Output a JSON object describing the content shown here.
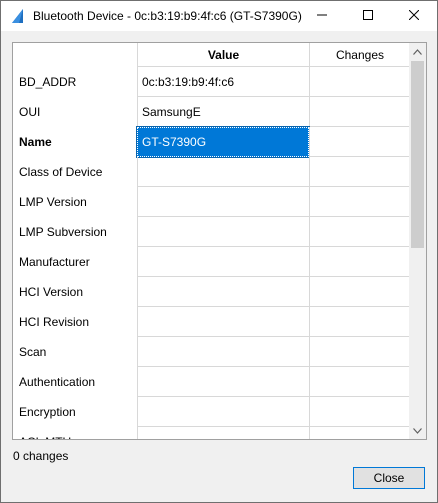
{
  "window": {
    "title": "Bluetooth Device - 0c:b3:19:b9:4f:c6 (GT-S7390G)"
  },
  "grid": {
    "headers": {
      "label": "",
      "value": "Value",
      "changes": "Changes"
    },
    "rows": [
      {
        "label": "BD_ADDR",
        "value": "0c:b3:19:b9:4f:c6",
        "changes": "",
        "bold": false,
        "selected": false
      },
      {
        "label": "OUI",
        "value": "SamsungE",
        "changes": "",
        "bold": false,
        "selected": false
      },
      {
        "label": "Name",
        "value": "GT-S7390G",
        "changes": "",
        "bold": true,
        "selected": true
      },
      {
        "label": "Class of Device",
        "value": "",
        "changes": "",
        "bold": false,
        "selected": false
      },
      {
        "label": "LMP Version",
        "value": "",
        "changes": "",
        "bold": false,
        "selected": false
      },
      {
        "label": "LMP Subversion",
        "value": "",
        "changes": "",
        "bold": false,
        "selected": false
      },
      {
        "label": "Manufacturer",
        "value": "",
        "changes": "",
        "bold": false,
        "selected": false
      },
      {
        "label": "HCI Version",
        "value": "",
        "changes": "",
        "bold": false,
        "selected": false
      },
      {
        "label": "HCI Revision",
        "value": "",
        "changes": "",
        "bold": false,
        "selected": false
      },
      {
        "label": "Scan",
        "value": "",
        "changes": "",
        "bold": false,
        "selected": false
      },
      {
        "label": "Authentication",
        "value": "",
        "changes": "",
        "bold": false,
        "selected": false
      },
      {
        "label": "Encryption",
        "value": "",
        "changes": "",
        "bold": false,
        "selected": false
      },
      {
        "label": "ACL MTU",
        "value": "",
        "changes": "",
        "bold": false,
        "selected": false
      }
    ]
  },
  "status": {
    "text": "0 changes"
  },
  "buttons": {
    "close": "Close"
  },
  "icons": {
    "app": "bluetooth-sail-icon",
    "minimize": "minimize-icon",
    "maximize": "maximize-icon",
    "close": "close-icon",
    "scroll_up": "chevron-up-icon",
    "scroll_down": "chevron-down-icon"
  },
  "colors": {
    "selection": "#0078d7",
    "accent": "#1e6fc0"
  }
}
